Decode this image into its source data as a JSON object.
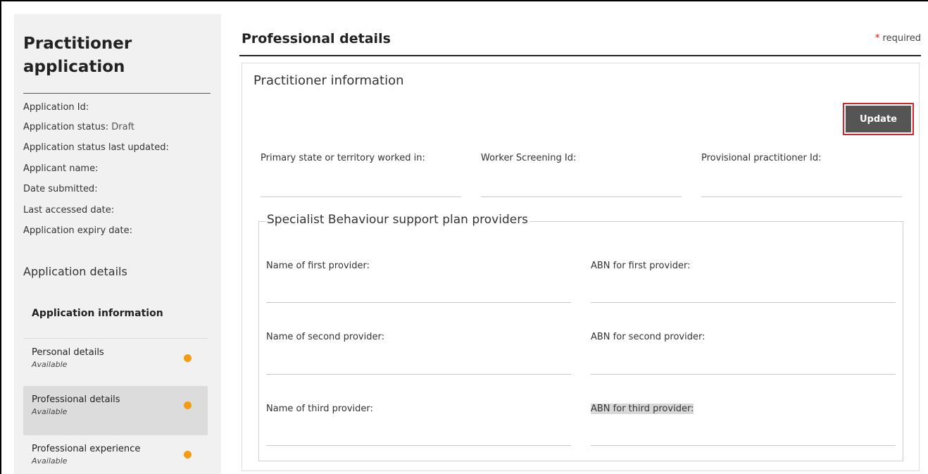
{
  "sidebar": {
    "title": "Practitioner application",
    "meta": [
      {
        "label": "Application Id:",
        "value": ""
      },
      {
        "label": "Application status:",
        "value": "Draft"
      },
      {
        "label": "Application status last updated:",
        "value": ""
      },
      {
        "label": "Applicant name:",
        "value": ""
      },
      {
        "label": "Date submitted:",
        "value": ""
      },
      {
        "label": "Last accessed date:",
        "value": ""
      },
      {
        "label": "Application expiry date:",
        "value": ""
      }
    ],
    "section_label": "Application details",
    "info_item": "Application information",
    "nav_items": [
      {
        "label": "Personal details",
        "status": "Available"
      },
      {
        "label": "Professional details",
        "status": "Available"
      },
      {
        "label": "Professional experience",
        "status": "Available"
      }
    ],
    "status_dot_color": "#f39c12"
  },
  "main": {
    "title": "Professional details",
    "required_star": "*",
    "required_text": "required",
    "panel_title": "Practitioner information",
    "update_label": "Update",
    "fields": {
      "primary_state": "Primary state or territory worked in:",
      "worker_screening": "Worker Screening Id:",
      "provisional_id": "Provisional practitioner Id:"
    },
    "providers": {
      "legend": "Specialist Behaviour support plan providers",
      "first_name": "Name of first provider:",
      "first_abn": "ABN for first provider:",
      "second_name": "Name of second provider:",
      "second_abn": "ABN for second provider:",
      "third_name": "Name of third provider:",
      "third_abn": "ABN for third provider:"
    }
  }
}
